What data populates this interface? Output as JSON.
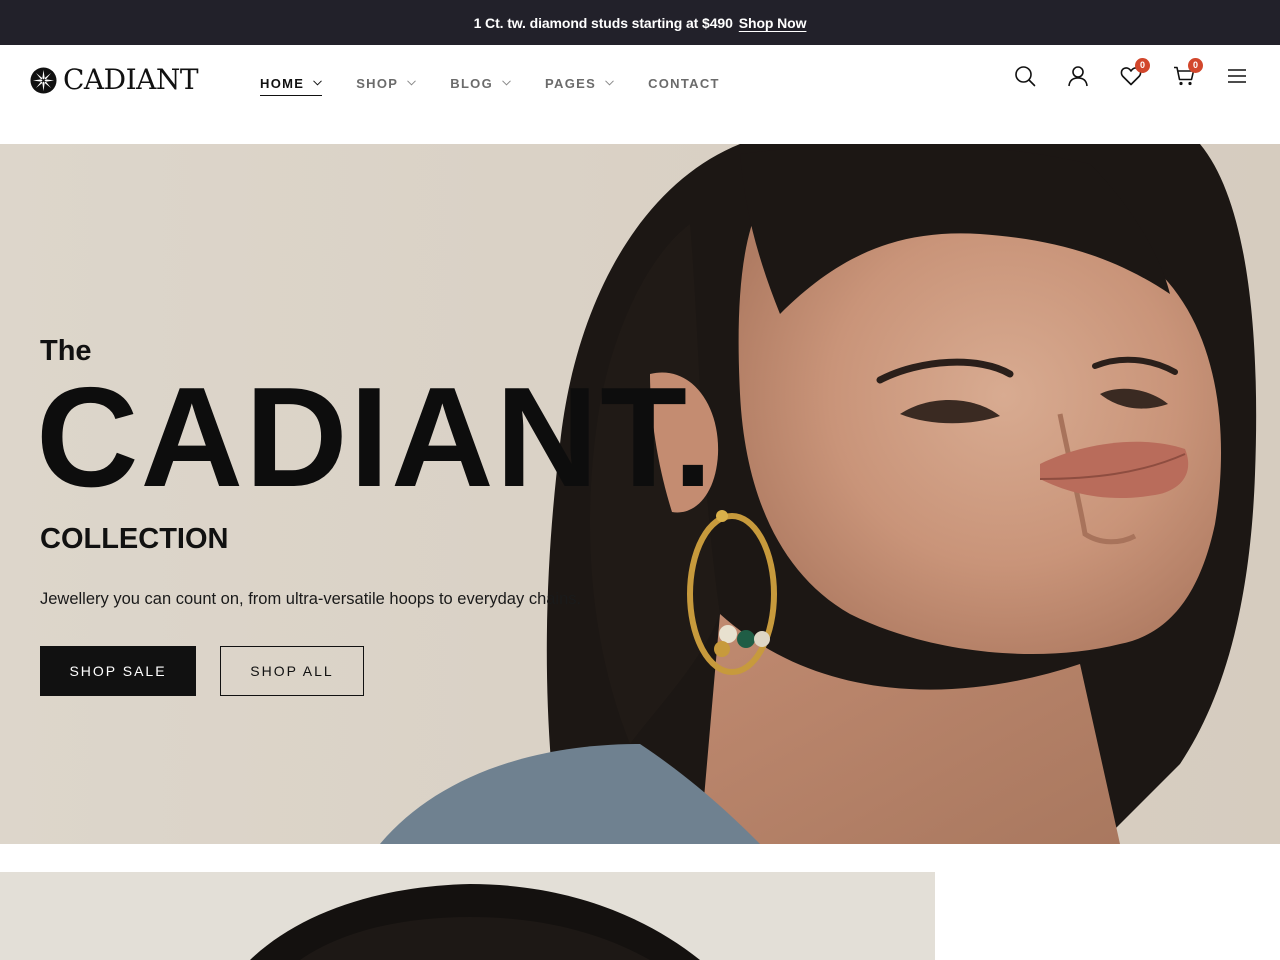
{
  "announcement": {
    "message": "1 Ct. tw. diamond studs starting at $490",
    "link_label": "Shop Now"
  },
  "header": {
    "logo_text": "CADIANT",
    "nav": [
      {
        "label": "HOME",
        "has_dropdown": true,
        "active": true
      },
      {
        "label": "SHOP",
        "has_dropdown": true,
        "active": false
      },
      {
        "label": "BLOG",
        "has_dropdown": true,
        "active": false
      },
      {
        "label": "PAGES",
        "has_dropdown": true,
        "active": false
      },
      {
        "label": "CONTACT",
        "has_dropdown": false,
        "active": false
      }
    ],
    "icons": {
      "search": "search-icon",
      "account": "user-icon",
      "wishlist": "heart-icon",
      "wishlist_count": "0",
      "cart": "cart-icon",
      "cart_count": "0",
      "menu": "hamburger-menu-icon"
    }
  },
  "hero": {
    "eyebrow": "The",
    "title": "CADIANT.",
    "subtitle": "COLLECTION",
    "description": "Jewellery you can count on, from ultra-versatile hoops to everyday chains.",
    "primary_cta": "SHOP SALE",
    "secondary_cta": "SHOP ALL"
  },
  "colors": {
    "announcement_bg": "#22212a",
    "badge": "#d2472c",
    "text": "#111111",
    "hero_bg": "#d9d1c5"
  }
}
